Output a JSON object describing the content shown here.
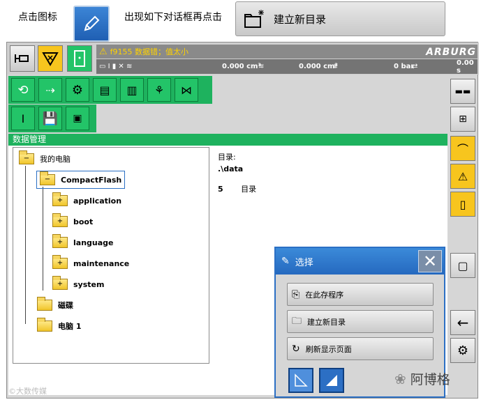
{
  "instructions": {
    "click_icon": "点击图标",
    "then_click": "出现如下对话框再点击",
    "new_dir_button": "建立新目录"
  },
  "header": {
    "alarm": "f9155 数据错；值太小",
    "logo": "ARBURG",
    "status_values": [
      "0.000 cm³",
      "0.000 cm³",
      "0 bar",
      "0.00 s"
    ]
  },
  "section_title": "数据管理",
  "tree": {
    "root": "我的电脑",
    "root_toggle": "−",
    "compactflash": "CompactFlash",
    "compactflash_toggle": "−",
    "children": [
      {
        "label": "application",
        "toggle": "+"
      },
      {
        "label": "boot",
        "toggle": "+"
      },
      {
        "label": "language",
        "toggle": "+"
      },
      {
        "label": "maintenance",
        "toggle": "+"
      },
      {
        "label": "system",
        "toggle": "+"
      }
    ],
    "disk": "磁碟",
    "computer1": "电脑 1"
  },
  "info": {
    "dir_label": "目录:",
    "dir_path": ".\\data",
    "count": "5",
    "count_label": "目录"
  },
  "dialog": {
    "title": "选择",
    "close": "✕",
    "buttons": [
      "在此存程序",
      "建立新目录",
      "刷新显示页面"
    ]
  },
  "watermark": "©大数传媒",
  "wechat_name": "阿博格",
  "colors": {
    "green": "#1eb25e",
    "yellow": "#f7c51e",
    "dialog_blue": "#2b6fc4"
  }
}
